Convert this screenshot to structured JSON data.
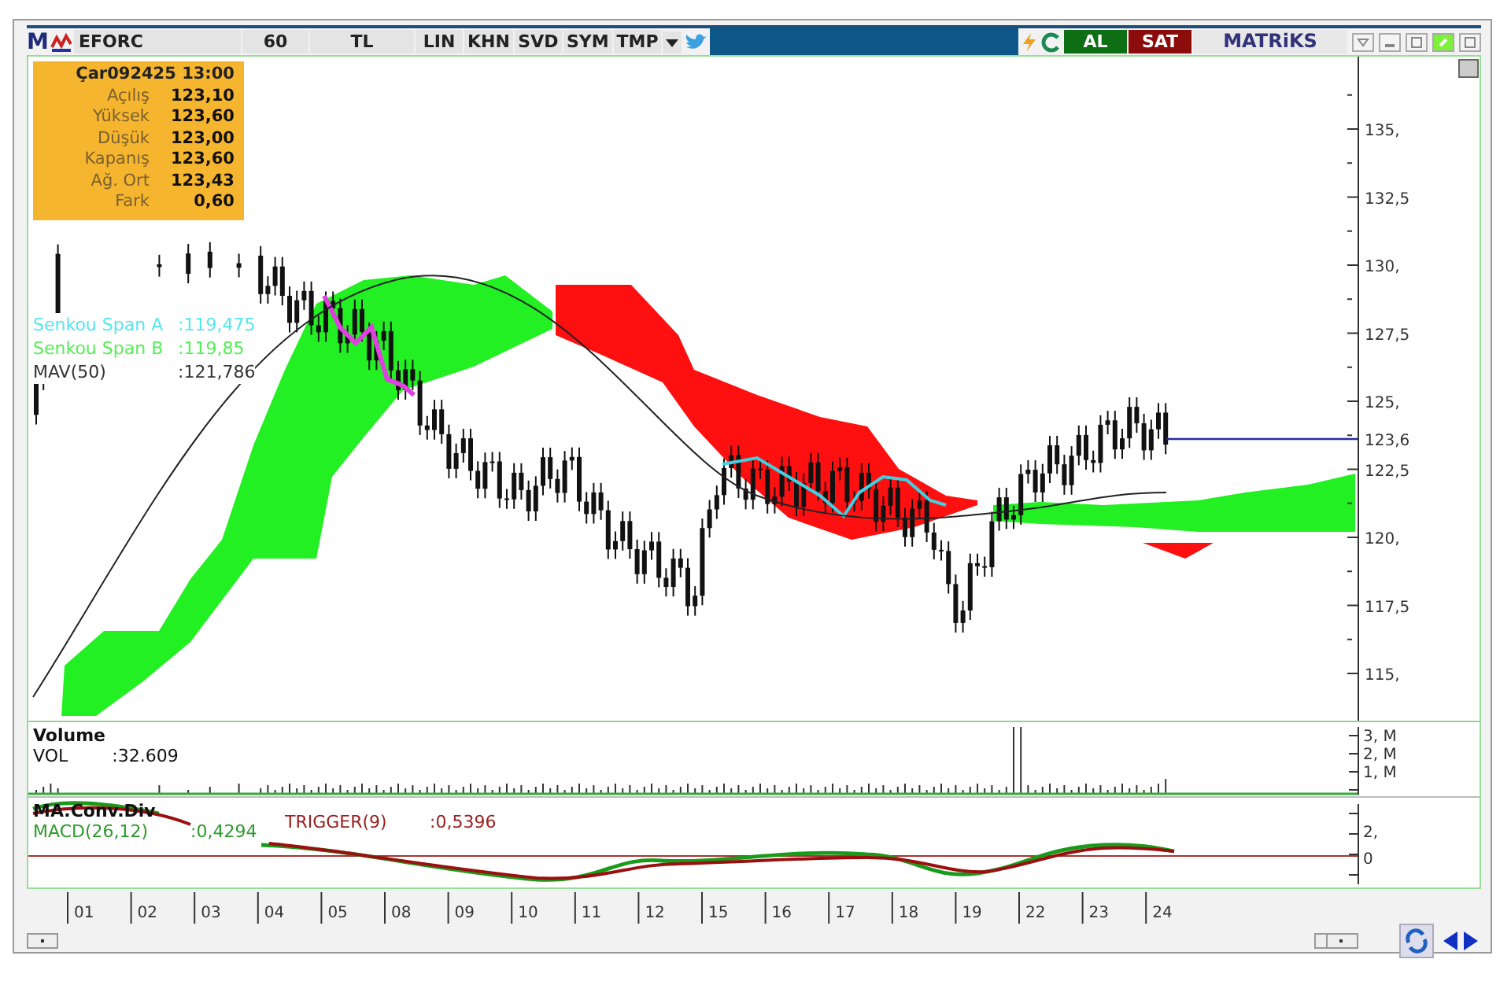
{
  "toolbar": {
    "logo": "M",
    "symbol": "EFORC",
    "period": "60",
    "currency": "TL",
    "buttons": [
      "LIN",
      "KHN",
      "SVD",
      "SYM",
      "TMP"
    ],
    "buy": "AL",
    "sell": "SAT",
    "brand": "MATRiKS"
  },
  "info_box": {
    "title": "Çar092425 13:00",
    "rows": [
      {
        "label": "Açılış",
        "value": "123,10"
      },
      {
        "label": "Yüksek",
        "value": "123,60"
      },
      {
        "label": "Düşük",
        "value": "123,00"
      },
      {
        "label": "Kapanış",
        "value": "123,60"
      },
      {
        "label": "Ağ. Ort",
        "value": "123,43"
      },
      {
        "label": "Fark",
        "value": "0,60"
      }
    ]
  },
  "main_chart": {
    "legends": [
      {
        "name": "Senkou Span A",
        "value": ":119,475",
        "color": "#55e6ee"
      },
      {
        "name": "Senkou Span B",
        "value": ":119,85",
        "color": "#55ee55"
      },
      {
        "name": "MAV(50)",
        "value": ":121,786",
        "color": "#333333"
      }
    ],
    "y_ticks": [
      "135,",
      "132,5",
      "130,",
      "127,5",
      "125,",
      "122,5",
      "120,",
      "117,5",
      "115,"
    ],
    "last_price": "123,6"
  },
  "volume_panel": {
    "title": "Volume",
    "series": "VOL",
    "value": ":32.609",
    "y_ticks": [
      "3, M",
      "2, M",
      "1, M"
    ]
  },
  "macd_panel": {
    "title": "MA.Conv.Div",
    "macd_label": "MACD(26,12)",
    "macd_value": ":0,4294",
    "trigger_label": "TRIGGER(9)",
    "trigger_value": ":0,5396",
    "y_ticks": [
      "2,",
      "0"
    ]
  },
  "x_ticks": [
    "01",
    "02",
    "03",
    "04",
    "05",
    "08",
    "09",
    "10",
    "11",
    "12",
    "15",
    "16",
    "17",
    "18",
    "19",
    "22",
    "23",
    "24"
  ]
}
